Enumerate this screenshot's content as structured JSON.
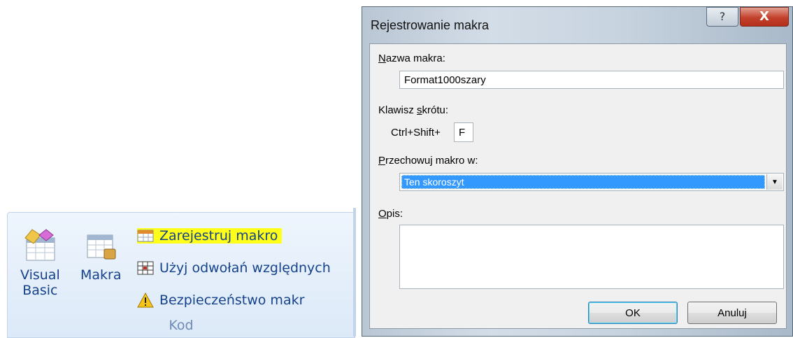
{
  "ribbon": {
    "visual_basic": {
      "line1": "Visual",
      "line2": "Basic"
    },
    "macros": {
      "label": "Makra"
    },
    "record_macro": {
      "label": "Zarejestruj makro"
    },
    "relative_refs": {
      "label": "Użyj odwołań względnych"
    },
    "macro_security": {
      "label": "Bezpieczeństwo makr"
    },
    "group_label": "Kod",
    "highlight_color": "#ffff1a"
  },
  "dialog": {
    "title": "Rejestrowanie makra",
    "help_glyph": "?",
    "close_glyph": "X",
    "macro_name": {
      "label_hotkey": "N",
      "label_rest": "azwa makra:",
      "value": "Format1000szary"
    },
    "shortcut": {
      "label_pre": "Klawisz ",
      "label_hotkey": "s",
      "label_rest": "krótu:",
      "prefix": "Ctrl+Shift+",
      "value": "F"
    },
    "store_in": {
      "label_hotkey": "P",
      "label_rest": "rzechowuj makro w:",
      "selected": "Ten skoroszyt"
    },
    "description": {
      "label_hotkey": "O",
      "label_rest": "pis:",
      "value": ""
    },
    "ok_label": "OK",
    "cancel_label": "Anuluj"
  }
}
